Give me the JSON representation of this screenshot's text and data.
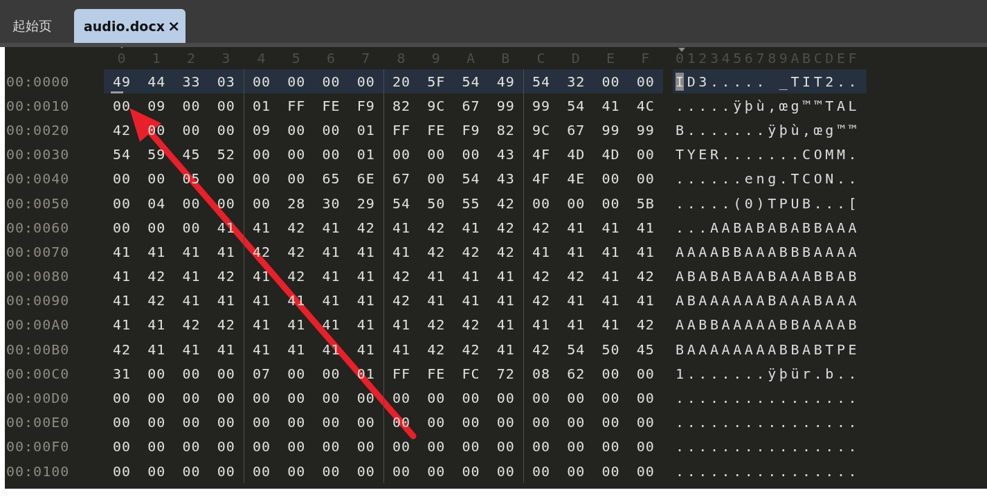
{
  "tabs": [
    {
      "label": "起始页",
      "selected": false
    },
    {
      "label": "audio.docx",
      "close": "×",
      "selected": true
    }
  ],
  "column_header": [
    "0",
    "1",
    "2",
    "3",
    "4",
    "5",
    "6",
    "7",
    "8",
    "9",
    "A",
    "B",
    "C",
    "D",
    "E",
    "F"
  ],
  "ascii_header": "0123456789ABCDEF",
  "rows": [
    {
      "address": "00:0000",
      "bytes": [
        "49",
        "44",
        "33",
        "03",
        "00",
        "00",
        "00",
        "00",
        "20",
        "5F",
        "54",
        "49",
        "54",
        "32",
        "00",
        "00"
      ],
      "ascii": "ID3..... _TIT2..",
      "selected": true,
      "cursor": true
    },
    {
      "address": "00:0010",
      "bytes": [
        "00",
        "09",
        "00",
        "00",
        "01",
        "FF",
        "FE",
        "F9",
        "82",
        "9C",
        "67",
        "99",
        "99",
        "54",
        "41",
        "4C"
      ],
      "ascii": ".....ÿþù‚œg™™TAL",
      "selected": false,
      "cursor": false
    },
    {
      "address": "00:0020",
      "bytes": [
        "42",
        "00",
        "00",
        "00",
        "09",
        "00",
        "00",
        "01",
        "FF",
        "FE",
        "F9",
        "82",
        "9C",
        "67",
        "99",
        "99"
      ],
      "ascii": "B.......ÿþù‚œg™™",
      "selected": false,
      "cursor": false
    },
    {
      "address": "00:0030",
      "bytes": [
        "54",
        "59",
        "45",
        "52",
        "00",
        "00",
        "00",
        "01",
        "00",
        "00",
        "00",
        "43",
        "4F",
        "4D",
        "4D",
        "00"
      ],
      "ascii": "TYER.......COMM.",
      "selected": false,
      "cursor": false
    },
    {
      "address": "00:0040",
      "bytes": [
        "00",
        "00",
        "05",
        "00",
        "00",
        "00",
        "65",
        "6E",
        "67",
        "00",
        "54",
        "43",
        "4F",
        "4E",
        "00",
        "00"
      ],
      "ascii": "......eng.TCON..",
      "selected": false,
      "cursor": false
    },
    {
      "address": "00:0050",
      "bytes": [
        "00",
        "04",
        "00",
        "00",
        "00",
        "28",
        "30",
        "29",
        "54",
        "50",
        "55",
        "42",
        "00",
        "00",
        "00",
        "5B"
      ],
      "ascii": ".....(0)TPUB...[",
      "selected": false,
      "cursor": false
    },
    {
      "address": "00:0060",
      "bytes": [
        "00",
        "00",
        "00",
        "41",
        "41",
        "42",
        "41",
        "42",
        "41",
        "42",
        "41",
        "42",
        "42",
        "41",
        "41",
        "41"
      ],
      "ascii": "...AABABABABBAAA",
      "selected": false,
      "cursor": false
    },
    {
      "address": "00:0070",
      "bytes": [
        "41",
        "41",
        "41",
        "41",
        "42",
        "42",
        "41",
        "41",
        "41",
        "42",
        "42",
        "42",
        "41",
        "41",
        "41",
        "41"
      ],
      "ascii": "AAAABBAAABBBAAAA",
      "selected": false,
      "cursor": false
    },
    {
      "address": "00:0080",
      "bytes": [
        "41",
        "42",
        "41",
        "42",
        "41",
        "42",
        "41",
        "41",
        "42",
        "41",
        "41",
        "41",
        "42",
        "42",
        "41",
        "42"
      ],
      "ascii": "ABABABAABAAABBAB",
      "selected": false,
      "cursor": false
    },
    {
      "address": "00:0090",
      "bytes": [
        "41",
        "42",
        "41",
        "41",
        "41",
        "41",
        "41",
        "41",
        "42",
        "41",
        "41",
        "41",
        "42",
        "41",
        "41",
        "41"
      ],
      "ascii": "ABAAAAAABAAABAAA",
      "selected": false,
      "cursor": false
    },
    {
      "address": "00:00A0",
      "bytes": [
        "41",
        "41",
        "42",
        "42",
        "41",
        "41",
        "41",
        "41",
        "41",
        "42",
        "42",
        "41",
        "41",
        "41",
        "41",
        "42"
      ],
      "ascii": "AABBAAAAABBAAAAB",
      "selected": false,
      "cursor": false
    },
    {
      "address": "00:00B0",
      "bytes": [
        "42",
        "41",
        "41",
        "41",
        "41",
        "41",
        "41",
        "41",
        "41",
        "42",
        "42",
        "41",
        "42",
        "54",
        "50",
        "45"
      ],
      "ascii": "BAAAAAAAABBABTPE",
      "selected": false,
      "cursor": false
    },
    {
      "address": "00:00C0",
      "bytes": [
        "31",
        "00",
        "00",
        "00",
        "07",
        "00",
        "00",
        "01",
        "FF",
        "FE",
        "FC",
        "72",
        "08",
        "62",
        "00",
        "00"
      ],
      "ascii": "1.......ÿþür.b..",
      "selected": false,
      "cursor": false
    },
    {
      "address": "00:00D0",
      "bytes": [
        "00",
        "00",
        "00",
        "00",
        "00",
        "00",
        "00",
        "00",
        "00",
        "00",
        "00",
        "00",
        "00",
        "00",
        "00",
        "00"
      ],
      "ascii": "................",
      "selected": false,
      "cursor": false
    },
    {
      "address": "00:00E0",
      "bytes": [
        "00",
        "00",
        "00",
        "00",
        "00",
        "00",
        "00",
        "00",
        "00",
        "00",
        "00",
        "00",
        "00",
        "00",
        "00",
        "00"
      ],
      "ascii": "................",
      "selected": false,
      "cursor": false
    },
    {
      "address": "00:00F0",
      "bytes": [
        "00",
        "00",
        "00",
        "00",
        "00",
        "00",
        "00",
        "00",
        "00",
        "00",
        "00",
        "00",
        "00",
        "00",
        "00",
        "00"
      ],
      "ascii": "................",
      "selected": false,
      "cursor": false
    },
    {
      "address": "00:0100",
      "bytes": [
        "00",
        "00",
        "00",
        "00",
        "00",
        "00",
        "00",
        "00",
        "00",
        "00",
        "00",
        "00",
        "00",
        "00",
        "00",
        "00"
      ],
      "ascii": "................",
      "selected": false,
      "cursor": false
    }
  ]
}
